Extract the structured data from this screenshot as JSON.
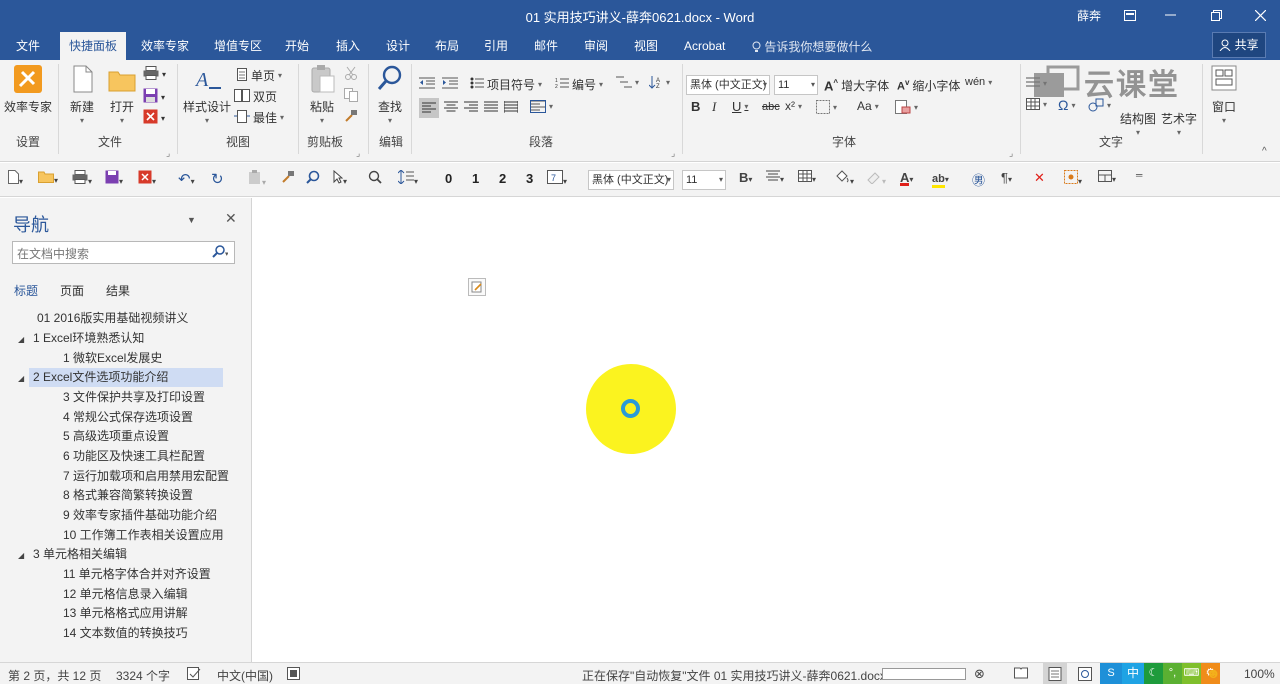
{
  "window": {
    "title": "01 实用技巧讲义-薛奔0621.docx  -  Word",
    "user": "薛奔"
  },
  "tabs": [
    "文件",
    "快捷面板",
    "效率专家",
    "增值专区",
    "开始",
    "插入",
    "设计",
    "布局",
    "引用",
    "邮件",
    "审阅",
    "视图",
    "Acrobat"
  ],
  "tell_me": "告诉我你想要做什么",
  "share": "共享",
  "ribbon": {
    "groups": {
      "settings": "设置",
      "file": "文件",
      "view": "视图",
      "clipboard": "剪贴板",
      "edit": "编辑",
      "paragraph": "段落",
      "font": "字体",
      "text": "文字"
    },
    "buttons": {
      "efficiency_expert": "效率专家",
      "new": "新建",
      "open": "打开",
      "style_design": "样式设计",
      "single_page": "单页",
      "double_page": "双页",
      "best": "最佳",
      "paste": "粘贴",
      "find": "查找",
      "bullets": "项目符号",
      "numbering": "编号",
      "grow_font": "增大字体",
      "shrink_font": "缩小字体",
      "structure_diagram": "结构图",
      "art_text": "艺术字",
      "window": "窗口"
    },
    "font_name": "黑体 (中文正文)",
    "font_size": "11",
    "watermark": "云课堂"
  },
  "qat": {
    "font_name": "黑体 (中文正文)",
    "font_size": "11",
    "numbers": [
      "0",
      "1",
      "2",
      "3"
    ]
  },
  "nav": {
    "title": "导航",
    "search_placeholder": "在文档中搜索",
    "tabs": [
      "标题",
      "页面",
      "结果"
    ],
    "headings": [
      "01 2016版实用基础视频讲义",
      "1 Excel环境熟悉认知",
      "1 微软Excel发展史",
      "2 Excel文件选项功能介绍",
      "3 文件保护共享及打印设置",
      "4 常规公式保存选项设置",
      "5 高级选项重点设置",
      "6 功能区及快速工具栏配置",
      "7 运行加载项和启用禁用宏配置",
      "8 格式兼容简繁转换设置",
      "9 效率专家插件基础功能介绍",
      "10 工作簿工作表相关设置应用",
      "3 单元格相关编辑",
      "11 单元格字体合并对齐设置",
      "12 单元格信息录入编辑",
      "13 单元格格式应用讲解",
      "14 文本数值的转换技巧"
    ]
  },
  "status": {
    "page": "第 2 页，共 12 页",
    "words": "3324 个字",
    "language": "中文(中国)",
    "saving": "正在保存\"自动恢复\"文件 01 实用技巧讲义-薛奔0621.docx:",
    "zoom": "100%",
    "ime": "中"
  }
}
